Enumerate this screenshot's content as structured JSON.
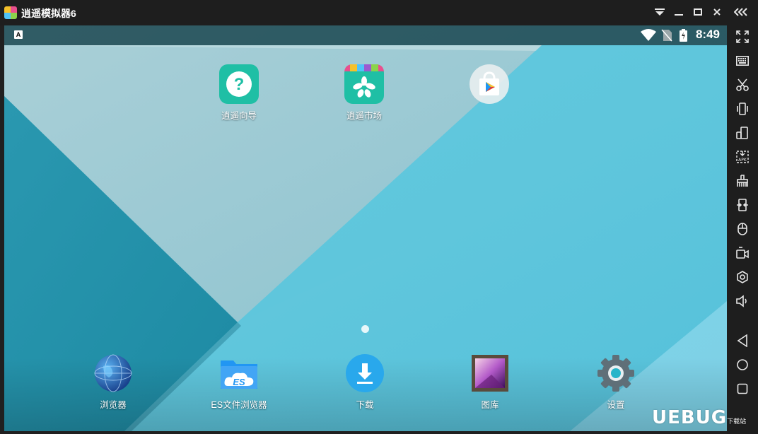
{
  "window": {
    "title": "逍遥模拟器6"
  },
  "titlebar": {
    "buttons": [
      "menu-dropdown",
      "minimize",
      "maximize",
      "close",
      "collapse-sidebar"
    ]
  },
  "statusbar": {
    "time": "8:49",
    "notification_badge": "A"
  },
  "home": {
    "top_apps": [
      {
        "label": "逍遥向导",
        "icon": "guide-icon"
      },
      {
        "label": "逍遥市场",
        "icon": "market-icon"
      },
      {
        "label": "",
        "icon": "play-store-icon"
      }
    ],
    "dock_apps": [
      {
        "label": "浏览器",
        "icon": "browser-globe-icon"
      },
      {
        "label": "ES文件浏览器",
        "icon": "es-file-explorer-icon"
      },
      {
        "label": "下载",
        "icon": "download-icon"
      },
      {
        "label": "图库",
        "icon": "gallery-icon"
      },
      {
        "label": "设置",
        "icon": "settings-gear-icon"
      }
    ]
  },
  "sidebar": {
    "tools": [
      "fullscreen-icon",
      "keyboard-icon",
      "scissors-icon",
      "shake-icon",
      "rotate-icon",
      "apk-install-icon",
      "cleanup-broom-icon",
      "sync-icon",
      "mouse-icon",
      "video-record-icon",
      "settings-icon",
      "volume-icon"
    ],
    "nav": [
      "back-icon",
      "home-icon",
      "recents-icon"
    ]
  },
  "watermark": {
    "text": "UEBUG",
    "sub": "下载站"
  },
  "colors": {
    "accent_teal": "#1fbfa5",
    "wallpaper": "#5fc7de",
    "titlebar": "#1e1e1e"
  }
}
